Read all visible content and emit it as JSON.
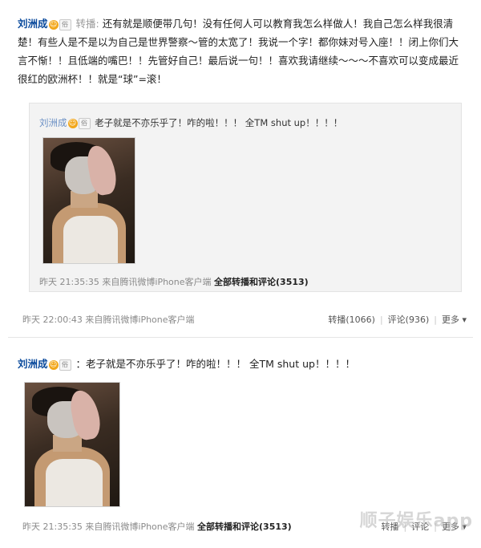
{
  "post1": {
    "author": "刘洲成",
    "badge": "☺",
    "vip": "俗",
    "tag": "转播:",
    "text": "还有就是顺便带几句！没有任何人可以教育我怎么样做人！我自己怎么样我很清楚！有些人是不是以为自己是世界警察～管的太宽了！我说一个字！都你妹对号入座！！闭上你们大言不惭！！且低端的嘴巴！！先管好自己！最后说一句！！喜欢我请继续～～～不喜欢可以变成最近很红的欧洲杯！！就是“球”=滚！",
    "quoted": {
      "author": "刘洲成",
      "badge": "☺",
      "vip": "俗",
      "text": "老子就是不亦乐乎了！咋的啦！！！ 全TM shut up！！！！",
      "meta_time": "昨天 21:35:35 来自腾讯微博iPhone客户端",
      "meta_link": "全部转播和评论(3513)"
    },
    "meta_time": "昨天 22:00:43 来自腾讯微博iPhone客户端",
    "actions": {
      "repost": "转播(1066)",
      "comment": "评论(936)",
      "more": "更多 ▾"
    }
  },
  "post2": {
    "author": "刘洲成",
    "badge": "☺",
    "vip": "俗",
    "text": "：老子就是不亦乐乎了！咋的啦！！！ 全TM shut up！！！！",
    "meta_time": "昨天 21:35:35 来自腾讯微博iPhone客户端",
    "meta_link": "全部转播和评论(3513)",
    "actions": {
      "repost": "转播",
      "comment": "评论",
      "more": "更多 ▾"
    }
  },
  "watermark": "顺子娱乐app"
}
